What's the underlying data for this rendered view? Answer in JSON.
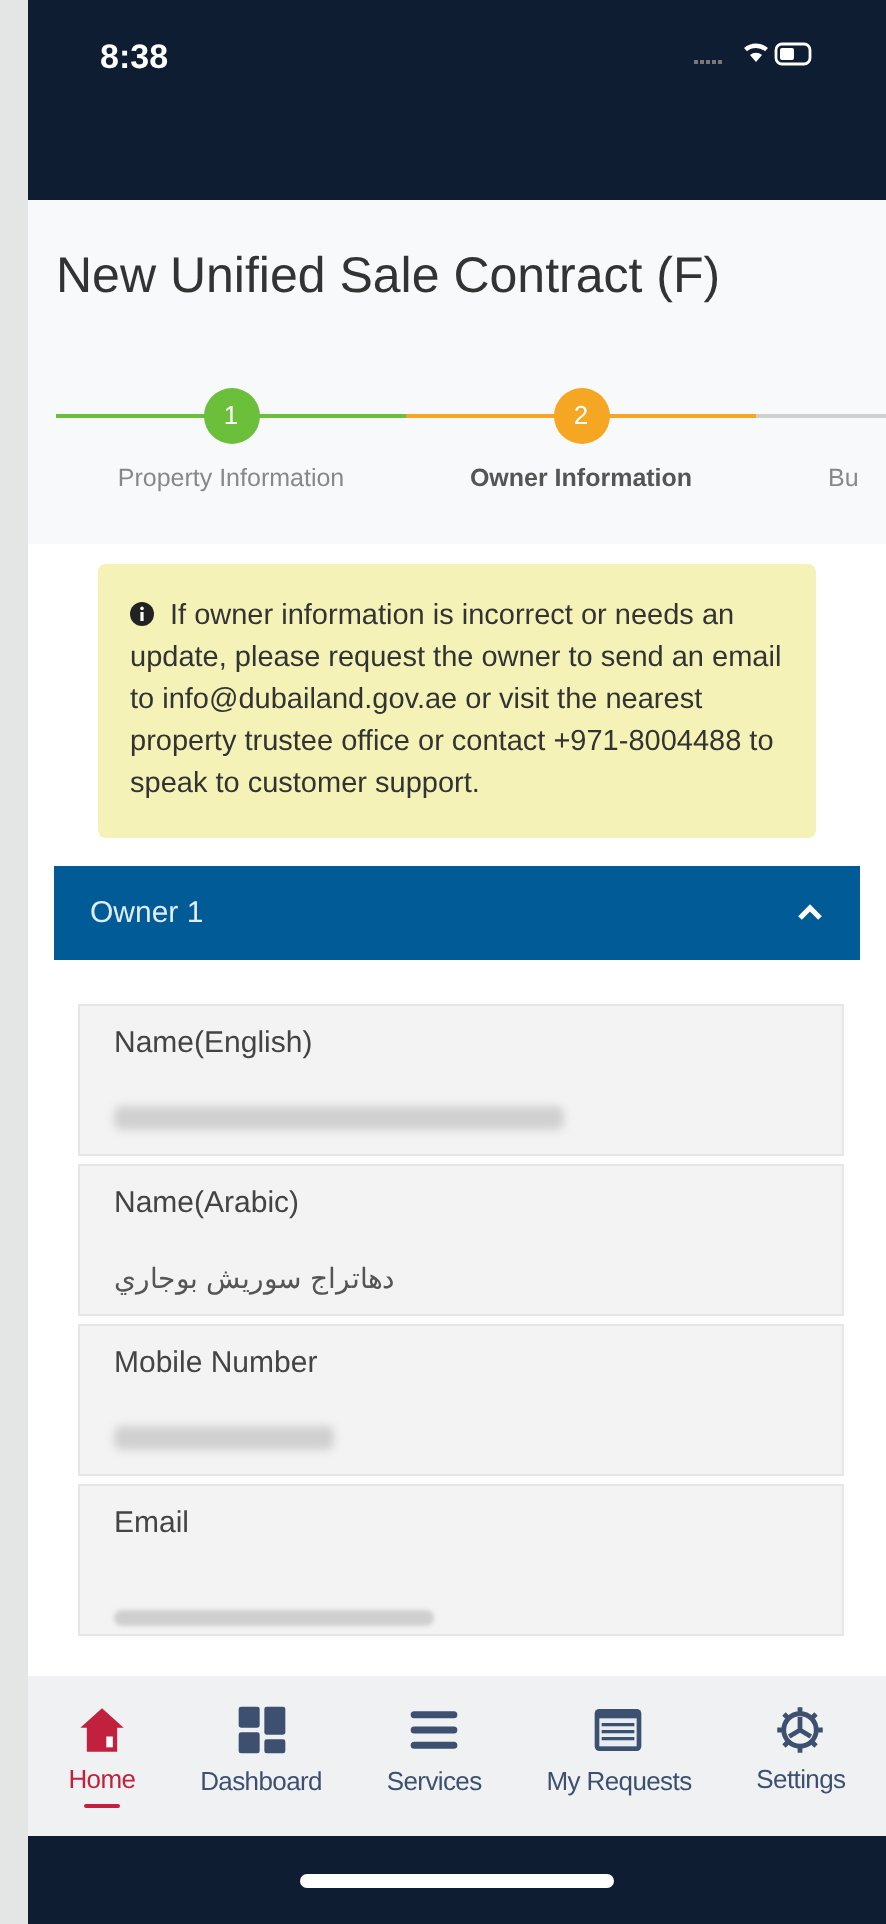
{
  "status_bar": {
    "time": "8:38"
  },
  "title": "New Unified Sale Contract (F)",
  "steps": [
    {
      "number": "1",
      "label": "Property Information",
      "kind": "done"
    },
    {
      "number": "2",
      "label": "Owner Information",
      "kind": "current"
    },
    {
      "label": "Bu",
      "kind": "upcoming"
    }
  ],
  "notice": "If owner information is incorrect or needs an update, please request the owner to send an email to info@dubailand.gov.ae or visit the nearest property trustee office or contact +971-8004488 to speak to customer support.",
  "owner_section": {
    "title": "Owner 1",
    "expanded": true,
    "fields": [
      {
        "label": "Name(English)",
        "kind": "blurred"
      },
      {
        "label": "Name(Arabic)",
        "kind": "text",
        "value": "دهاتراج سوريش بوجاري"
      },
      {
        "label": "Mobile Number",
        "kind": "blurred"
      },
      {
        "label": "Email",
        "kind": "cut"
      }
    ]
  },
  "nav": [
    {
      "label": "Home",
      "selected": true
    },
    {
      "label": "Dashboard",
      "selected": false
    },
    {
      "label": "Services",
      "selected": false
    },
    {
      "label": "My Requests",
      "selected": false
    },
    {
      "label": "Settings",
      "selected": false
    }
  ]
}
